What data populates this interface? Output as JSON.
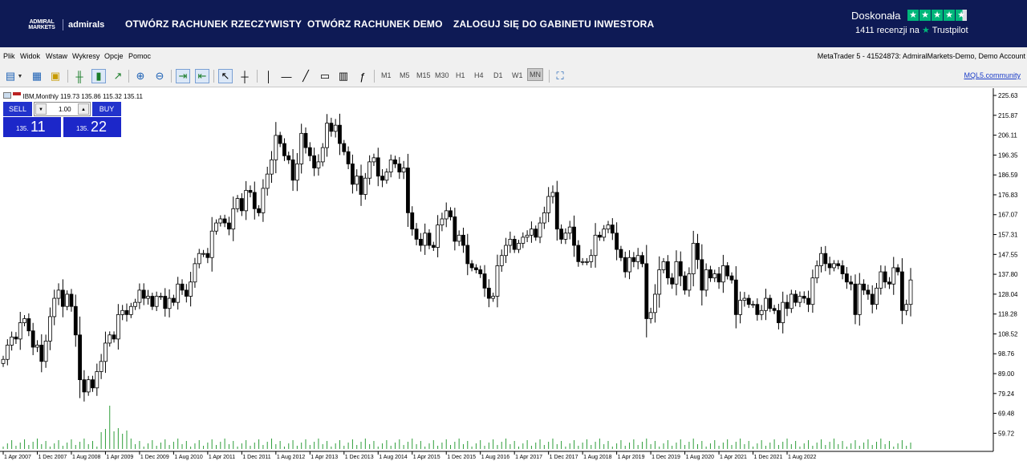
{
  "topbar": {
    "logo_mark": "ADMIRAL MARKETS",
    "logo_word": "admirals",
    "nav": [
      "OTWÓRZ RACHUNEK RZECZYWISTY",
      "OTWÓRZ RACHUNEK DEMO",
      "ZALOGUJ SIĘ DO GABINETU INWESTORA"
    ],
    "rating_label": "Doskonała",
    "reviews_text": "1411 recenzji na",
    "trustpilot": "Trustpilot",
    "stars": 4.5,
    "star_color": "#00b67a",
    "background": "#0e1a55"
  },
  "menubar": {
    "items": [
      "Plik",
      "Widok",
      "Wstaw",
      "Wykresy",
      "Opcje",
      "Pomoc"
    ],
    "account": "MetaTrader 5 - 41524873: AdmiralMarkets-Demo, Demo Account"
  },
  "toolbar": {
    "timeframes": [
      "M1",
      "M5",
      "M15",
      "M30",
      "H1",
      "H4",
      "D1",
      "W1",
      "MN"
    ],
    "active_timeframe": "MN",
    "mql_link": "MQL5.community"
  },
  "chart": {
    "symbol_label": "IBM,Monthly",
    "ohlc_text": "119.73 135.86 115.32 135.11",
    "sell_label": "SELL",
    "buy_label": "BUY",
    "lot": "1.00",
    "sell_prefix": "135.",
    "sell_big": "11",
    "buy_prefix": "135.",
    "buy_big": "22"
  },
  "chart_data": {
    "type": "candlestick",
    "symbol": "IBM",
    "timeframe": "Monthly",
    "y_ticks": [
      "225.63",
      "215.87",
      "206.11",
      "196.35",
      "186.59",
      "176.83",
      "167.07",
      "157.31",
      "147.55",
      "137.80",
      "128.04",
      "118.28",
      "108.52",
      "98.76",
      "89.00",
      "79.24",
      "69.48",
      "59.72"
    ],
    "ylim": [
      52.0,
      228.0
    ],
    "x_ticks": [
      "1 Apr 2007",
      "1 Dec 2007",
      "1 Aug 2008",
      "1 Apr 2009",
      "1 Dec 2009",
      "1 Aug 2010",
      "1 Apr 2011",
      "1 Dec 2011",
      "1 Aug 2012",
      "1 Apr 2013",
      "1 Dec 2013",
      "1 Aug 2014",
      "1 Apr 2015",
      "1 Dec 2015",
      "1 Aug 2016",
      "1 Apr 2017",
      "1 Dec 2017",
      "1 Aug 2018",
      "1 Apr 2019",
      "1 Dec 2019",
      "1 Aug 2020",
      "1 Apr 2021",
      "1 Dec 2021",
      "1 Aug 2022"
    ],
    "bull_color": "#ffffff",
    "bear_color": "#000000",
    "volume_color": "#2e9e3a",
    "closes": [
      96,
      103,
      107,
      106,
      114,
      116,
      110,
      102,
      103,
      95,
      105,
      117,
      126,
      130,
      122,
      128,
      122,
      108,
      86,
      80,
      86,
      82,
      90,
      95,
      104,
      108,
      106,
      118,
      120,
      118,
      122,
      124,
      130,
      126,
      127,
      122,
      127,
      127,
      121,
      126,
      124,
      133,
      130,
      127,
      134,
      143,
      148,
      148,
      146,
      159,
      163,
      165,
      163,
      160,
      170,
      175,
      169,
      179,
      178,
      170,
      168,
      180,
      187,
      194,
      206,
      202,
      196,
      194,
      184,
      192,
      207,
      200,
      196,
      190,
      193,
      200,
      212,
      208,
      211,
      202,
      198,
      192,
      182,
      186,
      177,
      185,
      193,
      195,
      186,
      184,
      188,
      194,
      192,
      188,
      190,
      168,
      160,
      155,
      152,
      158,
      152,
      151,
      162,
      165,
      169,
      166,
      154,
      157,
      152,
      143,
      141,
      140,
      138,
      131,
      126,
      127,
      142,
      147,
      152,
      155,
      150,
      153,
      156,
      157,
      160,
      156,
      163,
      168,
      176,
      178,
      160,
      155,
      158,
      161,
      152,
      144,
      144,
      144,
      147,
      157,
      156,
      160,
      162,
      158,
      150,
      146,
      139,
      146,
      144,
      147,
      143,
      116,
      119,
      128,
      140,
      144,
      136,
      133,
      144,
      137,
      130,
      138,
      153,
      145,
      130,
      140,
      136,
      138,
      134,
      142,
      137,
      135,
      118,
      125,
      126,
      123,
      123,
      118,
      120,
      126,
      121,
      120,
      114,
      124,
      121,
      128,
      124,
      127,
      126,
      123,
      136,
      142,
      148,
      143,
      141,
      143,
      142,
      138,
      134,
      133,
      118,
      133,
      130,
      128,
      123,
      131,
      139,
      134,
      133,
      141,
      139,
      120,
      123,
      135
    ]
  }
}
